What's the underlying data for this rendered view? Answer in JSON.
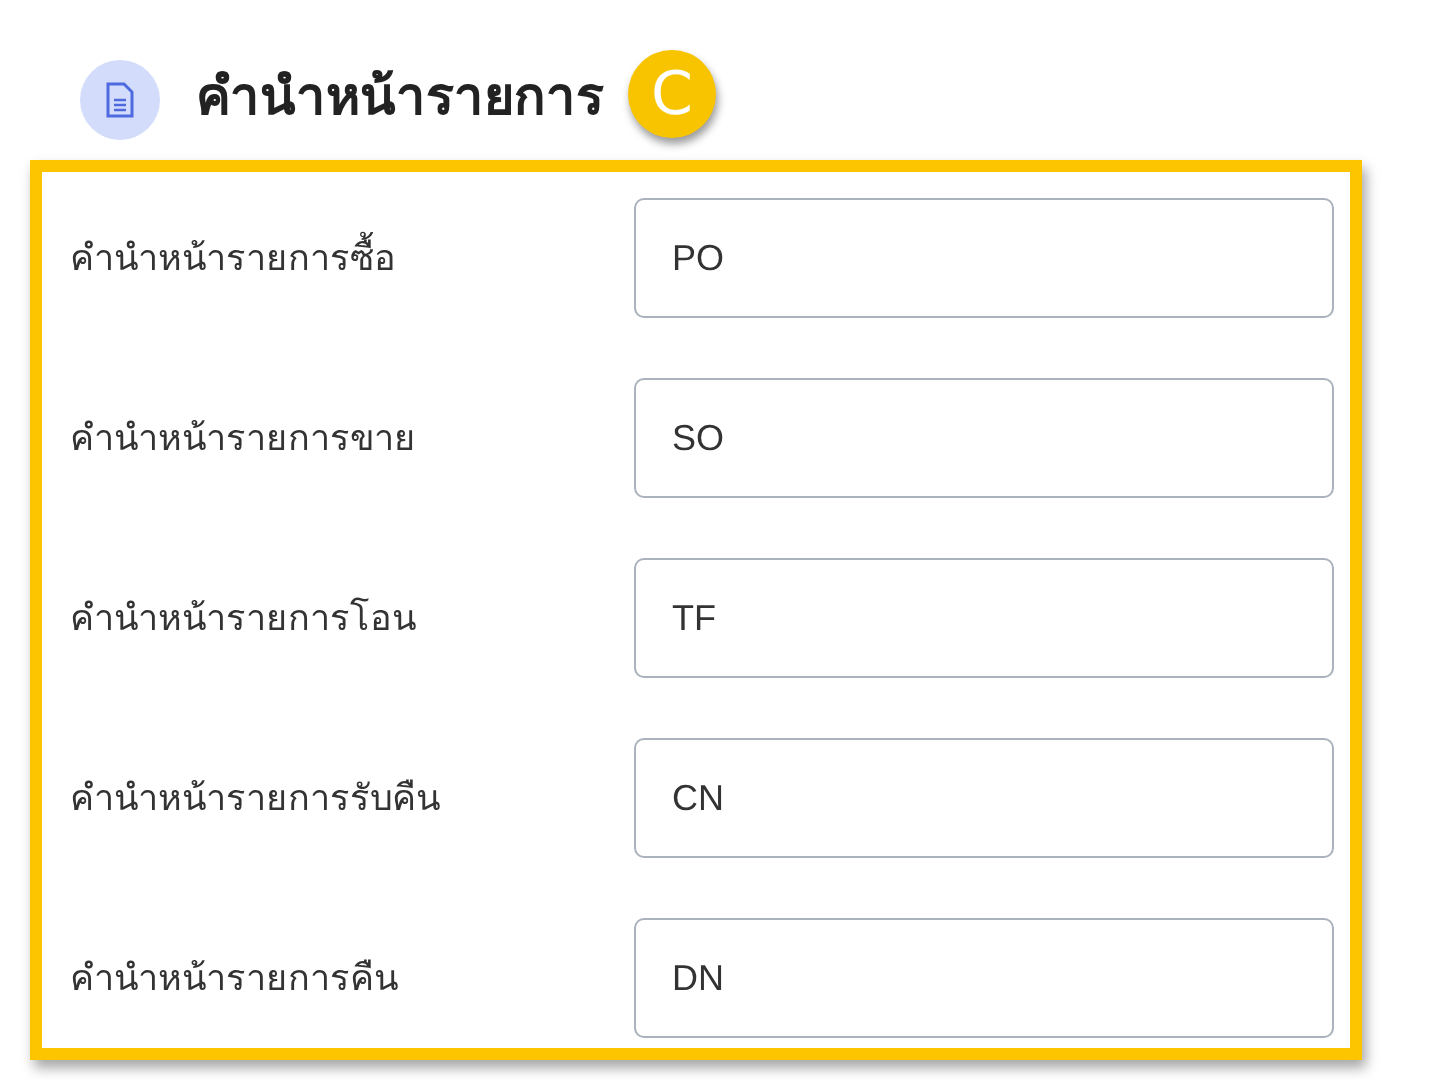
{
  "header": {
    "title": "คำนำหน้ารายการ",
    "badge": "C"
  },
  "fields": [
    {
      "label": "คำนำหน้ารายการซื้อ",
      "value": "PO"
    },
    {
      "label": "คำนำหน้ารายการขาย",
      "value": "SO"
    },
    {
      "label": "คำนำหน้ารายการโอน",
      "value": "TF"
    },
    {
      "label": "คำนำหน้ารายการรับคืน",
      "value": "CN"
    },
    {
      "label": "คำนำหน้ารายการคืน",
      "value": "DN"
    }
  ]
}
